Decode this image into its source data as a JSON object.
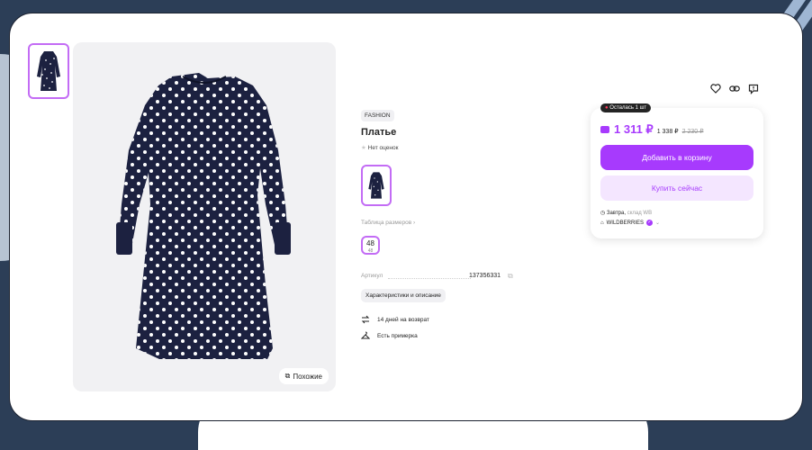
{
  "product": {
    "brand": "FASHION",
    "title": "Платье",
    "rating_text": "Нет оценок",
    "size_table_link": "Таблица размеров",
    "size": {
      "value": "48",
      "sub": "48"
    },
    "article_label": "Артикул",
    "article_value": "137356331",
    "characteristics_button": "Характеристики и описание",
    "return_text": "14 дней на возврат",
    "fitting_text": "Есть примерка",
    "similar_button": "Похожие"
  },
  "purchase": {
    "stock_badge": "Осталась 1 шт",
    "price_main": "1 311 ₽",
    "price_alt": "1 338 ₽",
    "price_old": "2 230 ₽",
    "add_to_cart": "Добавить в корзину",
    "buy_now": "Купить сейчас",
    "delivery_day": "Завтра,",
    "delivery_warehouse": "склад WB",
    "seller": "WILDBERRIES"
  },
  "icons": {
    "favorite": "heart-icon",
    "share": "link-icon",
    "report": "flag-icon",
    "copy": "copy-icon",
    "return": "return-arrows-icon",
    "fitting": "hanger-icon"
  },
  "colors": {
    "accent": "#a73afd",
    "accent_light": "#f4e6ff",
    "dress": "#1c2140",
    "dots": "#ffffff"
  }
}
